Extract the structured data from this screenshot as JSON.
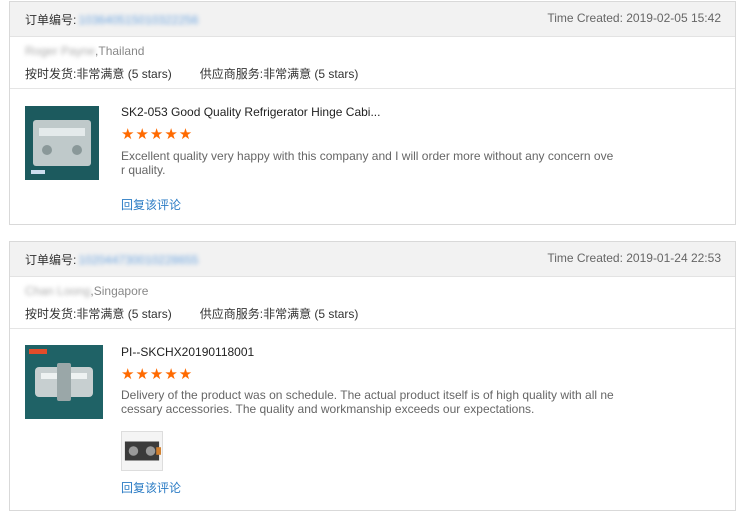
{
  "reviews": [
    {
      "order_label": "订单编号:",
      "order_number": "103640515010322256",
      "time_created": "Time Created: 2019-02-05 15:42",
      "buyer_name": "Roger Payne",
      "buyer_country": ",Thailand",
      "delivery_label": "按时发货:",
      "delivery_rating": "非常满意",
      "delivery_stars": "(5 stars)",
      "service_label": "供应商服务:",
      "service_rating": "非常满意",
      "service_stars": "(5 stars)",
      "product_title": "SK2-053 Good Quality Refrigerator Hinge Cabi...",
      "stars": "★★★★★",
      "rating": 5,
      "review_text": "Excellent quality very happy with this company and I will order more without any concern over quality.",
      "reply_label": "回复该评论"
    },
    {
      "order_label": "订单编号:",
      "order_number": "102044730010228655",
      "time_created": "Time Created: 2019-01-24 22:53",
      "buyer_name": "Chan Loong",
      "buyer_country": ",Singapore",
      "delivery_label": "按时发货:",
      "delivery_rating": "非常满意",
      "delivery_stars": "(5 stars)",
      "service_label": "供应商服务:",
      "service_rating": "非常满意",
      "service_stars": "(5 stars)",
      "product_title": "PI--SKCHX20190118001",
      "stars": "★★★★★",
      "rating": 5,
      "review_text": "Delivery of the product was on schedule. The actual product itself is of high quality with all necessary accessories. The quality and workmanship exceeds our expectations.",
      "reply_label": "回复该评论"
    }
  ],
  "colors": {
    "star": "#ff6a00",
    "link": "#2a7bc4",
    "header_bg": "#f2f2f2"
  }
}
